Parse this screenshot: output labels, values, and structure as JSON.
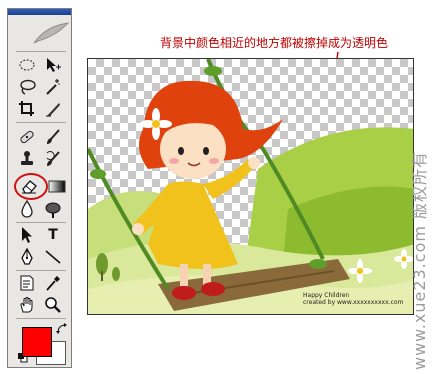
{
  "annotation": {
    "text": "背景中颜色相近的地方都被擦掉成为透明色"
  },
  "watermark": {
    "text": "www.xue23.com 版权所有"
  },
  "artwork": {
    "credit_line1": "Happy Children",
    "credit_line2": "created by www.xxxxxxxxxx.com"
  },
  "toolbar": {
    "tools": [
      {
        "name": "elliptical-marquee-tool-icon"
      },
      {
        "name": "move-tool-icon"
      },
      {
        "name": "lasso-tool-icon"
      },
      {
        "name": "magic-wand-tool-icon"
      },
      {
        "name": "crop-tool-icon"
      },
      {
        "name": "slice-tool-icon"
      },
      {
        "name": "healing-brush-tool-icon"
      },
      {
        "name": "brush-tool-icon"
      },
      {
        "name": "clone-stamp-tool-icon"
      },
      {
        "name": "history-brush-tool-icon"
      },
      {
        "name": "background-eraser-tool-icon"
      },
      {
        "name": "gradient-tool-icon"
      },
      {
        "name": "blur-tool-icon"
      },
      {
        "name": "dodge-tool-icon"
      },
      {
        "name": "path-selection-tool-icon"
      },
      {
        "name": "type-tool-icon"
      },
      {
        "name": "pen-tool-icon"
      },
      {
        "name": "line-tool-icon"
      },
      {
        "name": "notes-tool-icon"
      },
      {
        "name": "eyedropper-tool-icon"
      },
      {
        "name": "hand-tool-icon"
      },
      {
        "name": "zoom-tool-icon"
      }
    ],
    "type_label": "T",
    "foreground_color": "#ff0000",
    "background_color": "#ffffff"
  },
  "colors": {
    "annotation": "#c00000",
    "highlight": "#d11010",
    "watermark": "#9c9c9c"
  }
}
